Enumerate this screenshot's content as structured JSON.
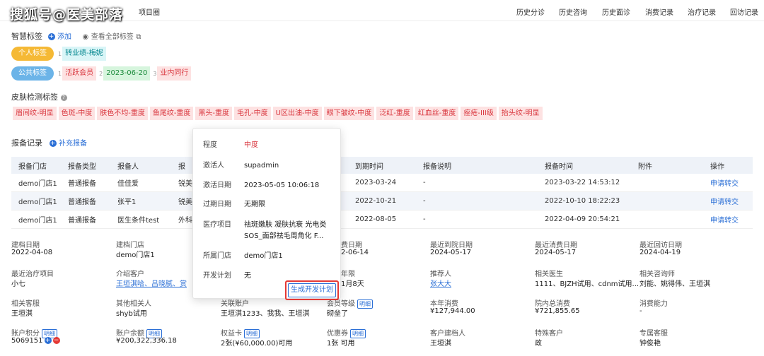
{
  "watermark": "搜狐号@医美部落",
  "top_tabs_left": [
    "项目圈"
  ],
  "top_tabs_right": [
    "历史分诊",
    "历史咨询",
    "历史面诊",
    "消费记录",
    "治疗记录",
    "回访记录"
  ],
  "smart_tags": {
    "title": "智慧标签",
    "add_label": "添加",
    "view_all_label": "查看全部标签",
    "personal": {
      "label": "个人标签",
      "color": "#f5b935",
      "chips": [
        {
          "idx": "1",
          "text": "转业绩-梅妮",
          "style": "cyan"
        }
      ]
    },
    "public": {
      "label": "公共标签",
      "color": "#6cb4e8",
      "chips": [
        {
          "idx": "1",
          "text": "活跃会员",
          "style": "pink"
        },
        {
          "idx": "2",
          "text": "2023-06-20",
          "style": "green"
        },
        {
          "idx": "3",
          "text": "业内同行",
          "style": "pink"
        }
      ]
    }
  },
  "skin": {
    "title": "皮肤检测标签",
    "chips": [
      "眉间纹-明显",
      "色斑-中度",
      "肤色不均-重度",
      "鱼尾纹-重度",
      "黑头-重度",
      "毛孔-中度",
      "U区出油-中度",
      "眼下皱纹-中度",
      "泛红-重度",
      "红血丝-重度",
      "痤疮-III级",
      "抬头纹-明显"
    ]
  },
  "report": {
    "title": "报备记录",
    "add_label": "补充报备",
    "headers": [
      "报备门店",
      "报备类型",
      "报备人",
      "报",
      "到期时间",
      "报备说明",
      "报备时间",
      "附件",
      "操作"
    ],
    "rows": [
      [
        "demo门店1",
        "普通报备",
        "佳佳爱",
        "锐美",
        "2023-03-24",
        "-",
        "2023-03-22 14:53:12",
        "",
        "申请转交"
      ],
      [
        "demo门店1",
        "普通报备",
        "张平1",
        "锐美",
        "2022-10-21",
        "-",
        "2022-10-10 18:22:23",
        "",
        "申请转交"
      ],
      [
        "demo门店1",
        "普通报备",
        "医生条件test",
        "外科",
        "2022-08-05",
        "-",
        "2022-04-09 20:54:21",
        "",
        "申请转交"
      ]
    ]
  },
  "info": [
    {
      "label": "建档日期",
      "value": "2022-04-08"
    },
    {
      "label": "建档门店",
      "value": "demo门店1"
    },
    {
      "label": "",
      "value": ""
    },
    {
      "label": "费日期",
      "value": "2-06-14"
    },
    {
      "label": "最近到院日期",
      "value": "2024-05-17"
    },
    {
      "label": "最近消费日期",
      "value": "2024-05-17"
    },
    {
      "label": "最近回访日期",
      "value": "2024-04-19"
    },
    {
      "label": "最近治疗项目",
      "value": "小七"
    },
    {
      "label": "介绍客户",
      "value": "王垣淇哈、吕晓腻、赏",
      "link": true
    },
    {
      "label": "",
      "value": ""
    },
    {
      "label": "年限",
      "value": "1月8天"
    },
    {
      "label": "推荐人",
      "value": "张大大",
      "link": true
    },
    {
      "label": "相关医生",
      "value": "1111、BJZH试用、cdnm试用..."
    },
    {
      "label": "相关咨询师",
      "value": "刘能、姚得伟、王垣淇"
    },
    {
      "label": "相关客服",
      "value": "王垣淇"
    },
    {
      "label": "其他相关人",
      "value": "shyb试用"
    },
    {
      "label": "关联账户",
      "value": "王垣淇1233、我我、王垣淇"
    },
    {
      "label": "会员等级",
      "value": "砌垒了",
      "detail": "明细"
    },
    {
      "label": "本年消费",
      "value": "¥127,944.00"
    },
    {
      "label": "院内总消费",
      "value": "¥721,855.65"
    },
    {
      "label": "消费能力",
      "value": "-"
    },
    {
      "label": "账户积分",
      "value": "5069151",
      "detail": "明细"
    },
    {
      "label": "账户余额",
      "value": "¥200,322,336.18",
      "detail": "明细"
    },
    {
      "label": "权益卡",
      "value": "2张(¥60,000.00)可用",
      "detail": "明细"
    },
    {
      "label": "优惠券",
      "value": "1张 可用",
      "detail": "明细"
    },
    {
      "label": "客户建档人",
      "value": "王垣淇"
    },
    {
      "label": "特殊客户",
      "value": "政"
    },
    {
      "label": "专属客服",
      "value": "钟俊艳"
    }
  ],
  "popover": {
    "rows": [
      {
        "label": "程度",
        "value": "中度",
        "red": true
      },
      {
        "label": "激活人",
        "value": "supadmin"
      },
      {
        "label": "激活日期",
        "value": "2023-05-05 10:06:18"
      },
      {
        "label": "过期日期",
        "value": "无期限"
      },
      {
        "label": "医疗项目",
        "value": "祛斑嫩肤 凝肤抗衰 光电类",
        "value2": "SOS_面部祛毛周角化 F..."
      },
      {
        "label": "所属门店",
        "value": "demo门店1"
      },
      {
        "label": "开发计划",
        "value": "无"
      }
    ],
    "button": "生成开发计划"
  }
}
